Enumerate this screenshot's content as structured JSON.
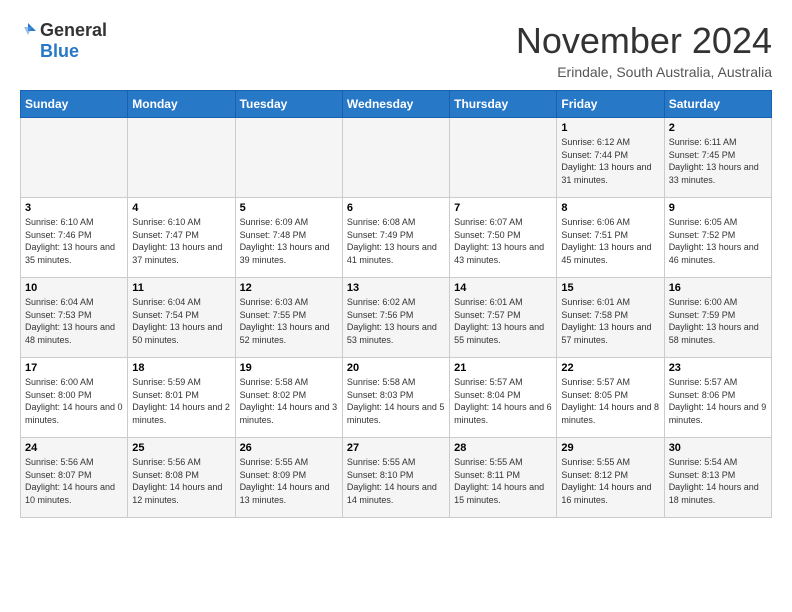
{
  "header": {
    "logo_general": "General",
    "logo_blue": "Blue",
    "month_title": "November 2024",
    "location": "Erindale, South Australia, Australia"
  },
  "calendar": {
    "days_of_week": [
      "Sunday",
      "Monday",
      "Tuesday",
      "Wednesday",
      "Thursday",
      "Friday",
      "Saturday"
    ],
    "weeks": [
      [
        {
          "day": "",
          "info": ""
        },
        {
          "day": "",
          "info": ""
        },
        {
          "day": "",
          "info": ""
        },
        {
          "day": "",
          "info": ""
        },
        {
          "day": "",
          "info": ""
        },
        {
          "day": "1",
          "info": "Sunrise: 6:12 AM\nSunset: 7:44 PM\nDaylight: 13 hours and 31 minutes."
        },
        {
          "day": "2",
          "info": "Sunrise: 6:11 AM\nSunset: 7:45 PM\nDaylight: 13 hours and 33 minutes."
        }
      ],
      [
        {
          "day": "3",
          "info": "Sunrise: 6:10 AM\nSunset: 7:46 PM\nDaylight: 13 hours and 35 minutes."
        },
        {
          "day": "4",
          "info": "Sunrise: 6:10 AM\nSunset: 7:47 PM\nDaylight: 13 hours and 37 minutes."
        },
        {
          "day": "5",
          "info": "Sunrise: 6:09 AM\nSunset: 7:48 PM\nDaylight: 13 hours and 39 minutes."
        },
        {
          "day": "6",
          "info": "Sunrise: 6:08 AM\nSunset: 7:49 PM\nDaylight: 13 hours and 41 minutes."
        },
        {
          "day": "7",
          "info": "Sunrise: 6:07 AM\nSunset: 7:50 PM\nDaylight: 13 hours and 43 minutes."
        },
        {
          "day": "8",
          "info": "Sunrise: 6:06 AM\nSunset: 7:51 PM\nDaylight: 13 hours and 45 minutes."
        },
        {
          "day": "9",
          "info": "Sunrise: 6:05 AM\nSunset: 7:52 PM\nDaylight: 13 hours and 46 minutes."
        }
      ],
      [
        {
          "day": "10",
          "info": "Sunrise: 6:04 AM\nSunset: 7:53 PM\nDaylight: 13 hours and 48 minutes."
        },
        {
          "day": "11",
          "info": "Sunrise: 6:04 AM\nSunset: 7:54 PM\nDaylight: 13 hours and 50 minutes."
        },
        {
          "day": "12",
          "info": "Sunrise: 6:03 AM\nSunset: 7:55 PM\nDaylight: 13 hours and 52 minutes."
        },
        {
          "day": "13",
          "info": "Sunrise: 6:02 AM\nSunset: 7:56 PM\nDaylight: 13 hours and 53 minutes."
        },
        {
          "day": "14",
          "info": "Sunrise: 6:01 AM\nSunset: 7:57 PM\nDaylight: 13 hours and 55 minutes."
        },
        {
          "day": "15",
          "info": "Sunrise: 6:01 AM\nSunset: 7:58 PM\nDaylight: 13 hours and 57 minutes."
        },
        {
          "day": "16",
          "info": "Sunrise: 6:00 AM\nSunset: 7:59 PM\nDaylight: 13 hours and 58 minutes."
        }
      ],
      [
        {
          "day": "17",
          "info": "Sunrise: 6:00 AM\nSunset: 8:00 PM\nDaylight: 14 hours and 0 minutes."
        },
        {
          "day": "18",
          "info": "Sunrise: 5:59 AM\nSunset: 8:01 PM\nDaylight: 14 hours and 2 minutes."
        },
        {
          "day": "19",
          "info": "Sunrise: 5:58 AM\nSunset: 8:02 PM\nDaylight: 14 hours and 3 minutes."
        },
        {
          "day": "20",
          "info": "Sunrise: 5:58 AM\nSunset: 8:03 PM\nDaylight: 14 hours and 5 minutes."
        },
        {
          "day": "21",
          "info": "Sunrise: 5:57 AM\nSunset: 8:04 PM\nDaylight: 14 hours and 6 minutes."
        },
        {
          "day": "22",
          "info": "Sunrise: 5:57 AM\nSunset: 8:05 PM\nDaylight: 14 hours and 8 minutes."
        },
        {
          "day": "23",
          "info": "Sunrise: 5:57 AM\nSunset: 8:06 PM\nDaylight: 14 hours and 9 minutes."
        }
      ],
      [
        {
          "day": "24",
          "info": "Sunrise: 5:56 AM\nSunset: 8:07 PM\nDaylight: 14 hours and 10 minutes."
        },
        {
          "day": "25",
          "info": "Sunrise: 5:56 AM\nSunset: 8:08 PM\nDaylight: 14 hours and 12 minutes."
        },
        {
          "day": "26",
          "info": "Sunrise: 5:55 AM\nSunset: 8:09 PM\nDaylight: 14 hours and 13 minutes."
        },
        {
          "day": "27",
          "info": "Sunrise: 5:55 AM\nSunset: 8:10 PM\nDaylight: 14 hours and 14 minutes."
        },
        {
          "day": "28",
          "info": "Sunrise: 5:55 AM\nSunset: 8:11 PM\nDaylight: 14 hours and 15 minutes."
        },
        {
          "day": "29",
          "info": "Sunrise: 5:55 AM\nSunset: 8:12 PM\nDaylight: 14 hours and 16 minutes."
        },
        {
          "day": "30",
          "info": "Sunrise: 5:54 AM\nSunset: 8:13 PM\nDaylight: 14 hours and 18 minutes."
        }
      ]
    ]
  }
}
